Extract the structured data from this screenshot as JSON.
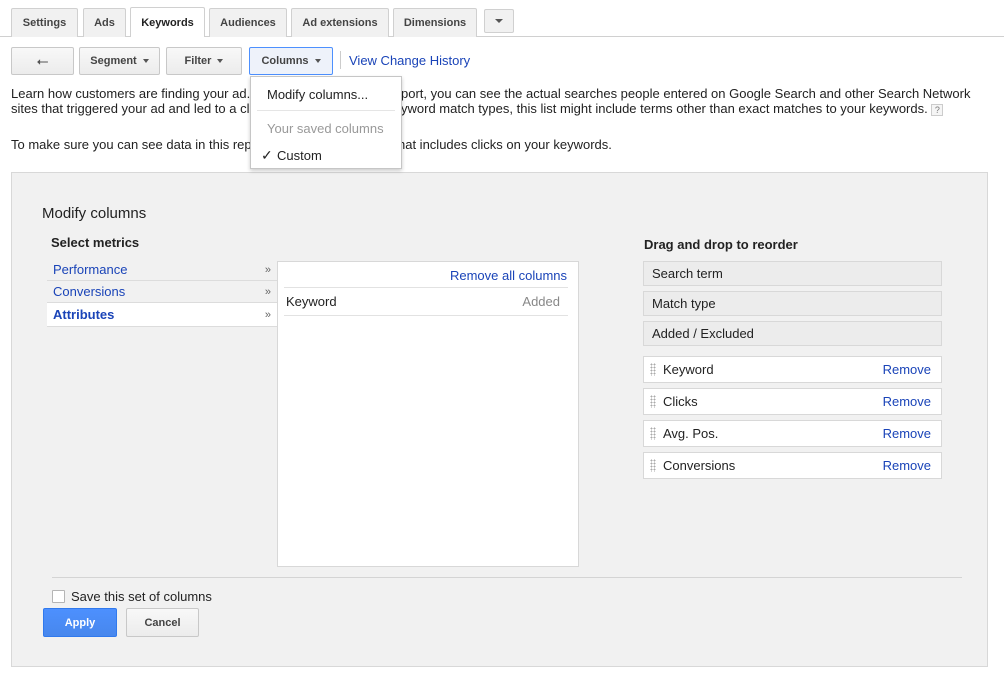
{
  "tabs": [
    {
      "label": "Settings"
    },
    {
      "label": "Ads"
    },
    {
      "label": "Keywords",
      "active": true
    },
    {
      "label": "Audiences"
    },
    {
      "label": "Ad extensions"
    },
    {
      "label": "Dimensions"
    }
  ],
  "toolbar": {
    "back_icon": "back-arrow-icon",
    "segment_label": "Segment",
    "filter_label": "Filter",
    "columns_label": "Columns",
    "history_link": "View Change History"
  },
  "info": {
    "line1_left": "Learn how customers are finding your ad.",
    "line1_right": "port, you can see the actual searches people entered on Google Search and other Search Network",
    "line2_left": "sites that triggered your ad and led to a cl",
    "line2_right": "yword match types, this list might include terms other than exact matches to your keywords.",
    "help": "?",
    "line3_left": "To make sure you can see data in this rep",
    "line3_right": "hat includes clicks on your keywords."
  },
  "dropdown": {
    "modify": "Modify columns...",
    "saved_header": "Your saved columns",
    "custom": "Custom",
    "check": "✓"
  },
  "panel": {
    "title": "Modify columns",
    "select_metrics": "Select metrics",
    "categories": [
      {
        "label": "Performance"
      },
      {
        "label": "Conversions"
      },
      {
        "label": "Attributes",
        "active": true
      }
    ],
    "chevron": "»",
    "remove_all": "Remove all columns",
    "columns": [
      {
        "name": "Keyword",
        "status": "Added"
      }
    ],
    "reorder_title": "Drag and drop to reorder",
    "fixed_columns": [
      "Search term",
      "Match type",
      "Added / Excluded"
    ],
    "draggable_columns": [
      "Keyword",
      "Clicks",
      "Avg. Pos.",
      "Conversions"
    ],
    "remove_label": "Remove",
    "save_label": "Save this set of columns",
    "apply_label": "Apply",
    "cancel_label": "Cancel"
  },
  "colors": {
    "link": "#1a44b8",
    "apply_bg": "#4d90fe",
    "panel_bg": "#f1f1f1"
  }
}
